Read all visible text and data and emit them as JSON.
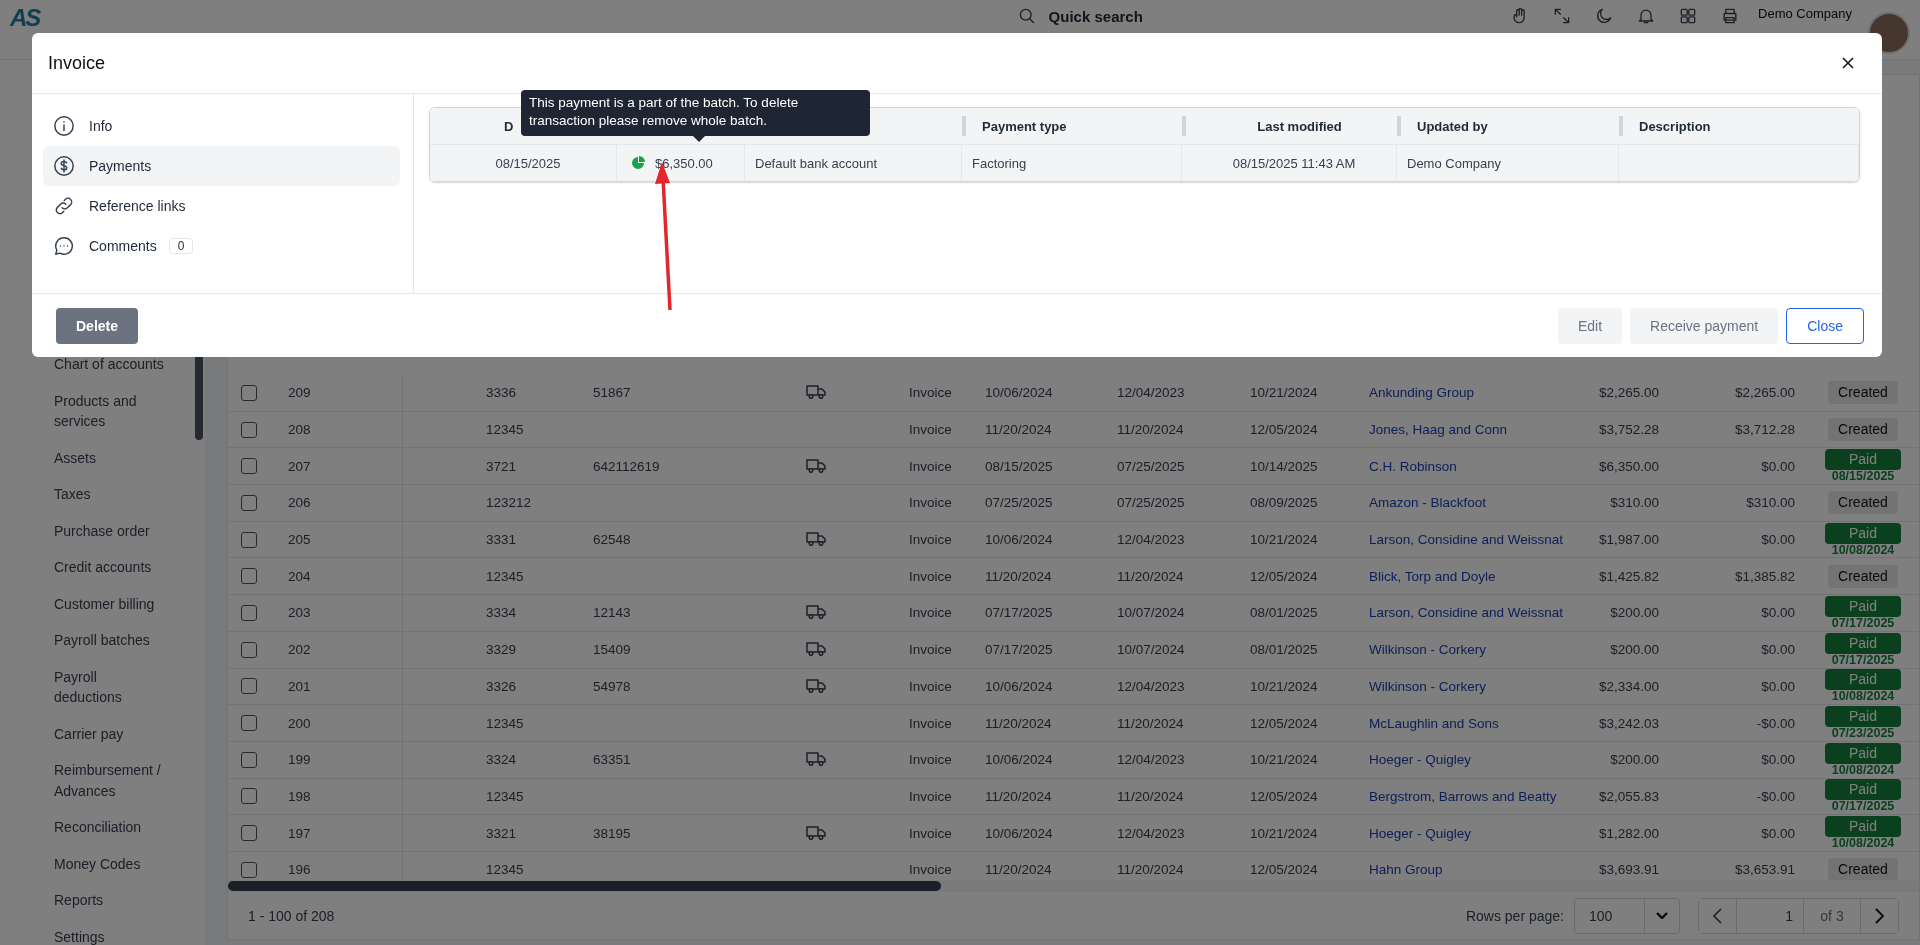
{
  "app_bar": {
    "logo": "AS",
    "search": {
      "placeholder": "Quick search"
    },
    "company": "Demo Company"
  },
  "sidebar": {
    "items": [
      {
        "label": "Chart of accounts"
      },
      {
        "label": "Products and services"
      },
      {
        "label": "Assets"
      },
      {
        "label": "Taxes"
      },
      {
        "label": "Purchase order"
      },
      {
        "label": "Credit accounts"
      },
      {
        "label": "Customer billing"
      },
      {
        "label": "Payroll batches"
      },
      {
        "label": "Payroll deductions"
      },
      {
        "label": "Carrier pay"
      },
      {
        "label": "Reimbursement / Advances"
      },
      {
        "label": "Reconciliation"
      },
      {
        "label": "Money Codes"
      },
      {
        "label": "Reports"
      },
      {
        "label": "Settings"
      }
    ]
  },
  "table": {
    "rows": [
      {
        "checked": false,
        "id": "209",
        "column_3": "3336",
        "column_4": "51867",
        "load": true,
        "type": "Invoice",
        "date_1": "10/06/2024",
        "date_2": "12/04/2023",
        "date_3": "10/21/2024",
        "customer": "Ankunding Group",
        "amount": "$2,265.00",
        "balance": "$2,265.00",
        "status": {
          "kind": "created",
          "label": "Created"
        }
      },
      {
        "checked": false,
        "id": "208",
        "column_3": "12345",
        "load": false,
        "type": "Invoice",
        "date_1": "11/20/2024",
        "date_2": "11/20/2024",
        "date_3": "12/05/2024",
        "customer": "Jones, Haag and Conn",
        "amount": "$3,752.28",
        "balance": "$3,712.28",
        "status": {
          "kind": "created",
          "label": "Created"
        }
      },
      {
        "checked": false,
        "id": "207",
        "column_3": "3721",
        "column_4": "642112619",
        "load": true,
        "type": "Invoice",
        "date_1": "08/15/2025",
        "date_2": "07/25/2025",
        "date_3": "10/14/2025",
        "customer": "C.H. Robinson",
        "amount": "$6,350.00",
        "balance": "$0.00",
        "status": {
          "kind": "paid",
          "label": "Paid",
          "date": "08/15/2025"
        }
      },
      {
        "checked": false,
        "id": "206",
        "column_3": "123212",
        "load": false,
        "type": "Invoice",
        "date_1": "07/25/2025",
        "date_2": "07/25/2025",
        "date_3": "08/09/2025",
        "customer": "Amazon - Blackfoot",
        "amount": "$310.00",
        "balance": "$310.00",
        "status": {
          "kind": "created",
          "label": "Created"
        }
      },
      {
        "checked": false,
        "id": "205",
        "column_3": "3331",
        "column_4": "62548",
        "load": true,
        "type": "Invoice",
        "date_1": "10/06/2024",
        "date_2": "12/04/2023",
        "date_3": "10/21/2024",
        "customer": "Larson, Considine and Weissnat",
        "amount": "$1,987.00",
        "balance": "$0.00",
        "status": {
          "kind": "paid",
          "label": "Paid",
          "date": "10/08/2024"
        }
      },
      {
        "checked": false,
        "id": "204",
        "column_3": "12345",
        "load": false,
        "type": "Invoice",
        "date_1": "11/20/2024",
        "date_2": "11/20/2024",
        "date_3": "12/05/2024",
        "customer": "Blick, Torp and Doyle",
        "amount": "$1,425.82",
        "balance": "$1,385.82",
        "status": {
          "kind": "created",
          "label": "Created"
        }
      },
      {
        "checked": false,
        "id": "203",
        "column_3": "3334",
        "column_4": "12143",
        "load": true,
        "type": "Invoice",
        "date_1": "07/17/2025",
        "date_2": "10/07/2024",
        "date_3": "08/01/2025",
        "customer": "Larson, Considine and Weissnat",
        "amount": "$200.00",
        "balance": "$0.00",
        "status": {
          "kind": "paid",
          "label": "Paid",
          "date": "07/17/2025"
        }
      },
      {
        "checked": false,
        "id": "202",
        "column_3": "3329",
        "column_4": "15409",
        "load": true,
        "type": "Invoice",
        "date_1": "07/17/2025",
        "date_2": "10/07/2024",
        "date_3": "08/01/2025",
        "customer": "Wilkinson - Corkery",
        "amount": "$200.00",
        "balance": "$0.00",
        "status": {
          "kind": "paid",
          "label": "Paid",
          "date": "07/17/2025"
        }
      },
      {
        "checked": false,
        "id": "201",
        "column_3": "3326",
        "column_4": "54978",
        "load": true,
        "type": "Invoice",
        "date_1": "10/06/2024",
        "date_2": "12/04/2023",
        "date_3": "10/21/2024",
        "customer": "Wilkinson - Corkery",
        "amount": "$2,334.00",
        "balance": "$0.00",
        "status": {
          "kind": "paid",
          "label": "Paid",
          "date": "10/08/2024"
        }
      },
      {
        "checked": false,
        "id": "200",
        "column_3": "12345",
        "load": false,
        "type": "Invoice",
        "date_1": "11/20/2024",
        "date_2": "11/20/2024",
        "date_3": "12/05/2024",
        "customer": "McLaughlin and Sons",
        "amount": "$3,242.03",
        "balance": "-$0.00",
        "status": {
          "kind": "paid",
          "label": "Paid",
          "date": "07/23/2025"
        }
      },
      {
        "checked": false,
        "id": "199",
        "column_3": "3324",
        "column_4": "63351",
        "load": true,
        "type": "Invoice",
        "date_1": "10/06/2024",
        "date_2": "12/04/2023",
        "date_3": "10/21/2024",
        "customer": "Hoeger - Quigley",
        "amount": "$200.00",
        "balance": "$0.00",
        "status": {
          "kind": "paid",
          "label": "Paid",
          "date": "10/08/2024"
        }
      },
      {
        "checked": false,
        "id": "198",
        "column_3": "12345",
        "load": false,
        "type": "Invoice",
        "date_1": "11/20/2024",
        "date_2": "11/20/2024",
        "date_3": "12/05/2024",
        "customer": "Bergstrom, Barrows and Beatty",
        "amount": "$2,055.83",
        "balance": "-$0.00",
        "status": {
          "kind": "paid",
          "label": "Paid",
          "date": "07/17/2025"
        }
      },
      {
        "checked": false,
        "id": "197",
        "column_3": "3321",
        "column_4": "38195",
        "load": true,
        "type": "Invoice",
        "date_1": "10/06/2024",
        "date_2": "12/04/2023",
        "date_3": "10/21/2024",
        "customer": "Hoeger - Quigley",
        "amount": "$1,282.00",
        "balance": "$0.00",
        "status": {
          "kind": "paid",
          "label": "Paid",
          "date": "10/08/2024"
        }
      },
      {
        "checked": false,
        "id": "196",
        "column_3": "12345",
        "load": false,
        "type": "Invoice",
        "date_1": "11/20/2024",
        "date_2": "11/20/2024",
        "date_3": "12/05/2024",
        "customer": "Hahn Group",
        "amount": "$3,693.91",
        "balance": "$3,653.91",
        "status": {
          "kind": "created",
          "label": "Created"
        }
      }
    ],
    "footer": {
      "range": "1 - 100 of 208",
      "rows_per_page_label": "Rows per page:",
      "rows_per_page": "100",
      "page": "1",
      "page_count": "of 3"
    }
  },
  "modal": {
    "title": "Invoice",
    "nav": [
      {
        "label": "Info",
        "selected": false
      },
      {
        "label": "Payments",
        "selected": true
      },
      {
        "label": "Reference links",
        "selected": false
      },
      {
        "label": "Comments",
        "selected": false,
        "count": "0"
      }
    ],
    "payments": {
      "columns": [
        {
          "label": "D"
        },
        {},
        {},
        {
          "label": "Payment type"
        },
        {
          "label": "Last modified"
        },
        {
          "label": "Updated by"
        },
        {
          "label": "Description"
        }
      ],
      "rows": [
        {
          "date": "08/15/2025",
          "batch": true,
          "amount": "$6,350.00",
          "account": "Default bank account",
          "payment_type": "Factoring",
          "last_modified": "08/15/2025 11:43 AM",
          "updated_by": "Demo Company"
        }
      ]
    },
    "tooltip": "This payment is a part of the batch. To delete transaction please remove whole batch.",
    "annotation": {
      "kind": "arrow"
    },
    "buttons_left": [
      {
        "label": "Delete",
        "kind": "solid",
        "disabled": false
      }
    ],
    "buttons_right": [
      {
        "label": "Edit",
        "kind": "flat",
        "disabled": true
      },
      {
        "label": "Receive payment",
        "kind": "flat",
        "disabled": true
      },
      {
        "label": "Close",
        "kind": "outline",
        "disabled": false
      }
    ]
  }
}
